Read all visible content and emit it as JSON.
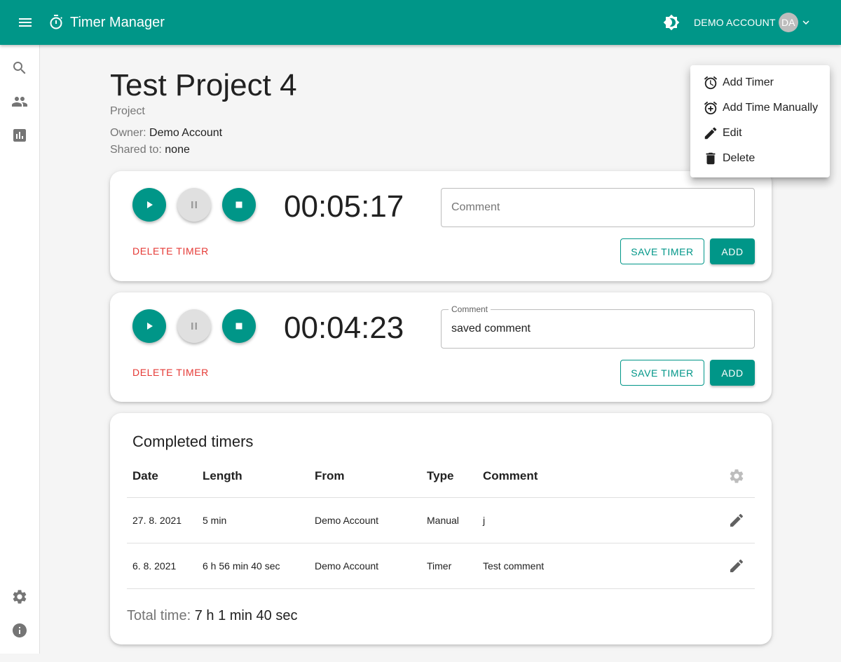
{
  "app": {
    "title": "Timer Manager",
    "account_name": "DEMO ACCOUNT",
    "avatar_initials": "DA",
    "accent_color": "#009688",
    "icons": [
      "menu-icon",
      "timer-icon",
      "brightness-icon",
      "chevron-down-icon",
      "search-icon",
      "people-icon",
      "chart-icon",
      "settings-icon",
      "info-icon"
    ]
  },
  "project": {
    "title": "Test Project 4",
    "type": "Project",
    "owner_label": "Owner:",
    "owner": "Demo Account",
    "shared_label": "Shared to:",
    "shared": "none"
  },
  "timers": [
    {
      "value": "00:05:17",
      "comment_placeholder": "Comment",
      "comment_value": "",
      "delete_label": "DELETE TIMER",
      "save_label": "SAVE TIMER",
      "add_label": "ADD"
    },
    {
      "value": "00:04:23",
      "comment_label": "Comment",
      "comment_value": "saved comment",
      "delete_label": "DELETE TIMER",
      "save_label": "SAVE TIMER",
      "add_label": "ADD"
    }
  ],
  "completed": {
    "title": "Completed timers",
    "headers": {
      "date": "Date",
      "length": "Length",
      "from": "From",
      "type": "Type",
      "comment": "Comment"
    },
    "rows": [
      {
        "date": "27. 8. 2021",
        "length": "5 min",
        "from": "Demo Account",
        "type": "Manual",
        "comment": "j"
      },
      {
        "date": "6. 8. 2021",
        "length": "6 h 56 min 40 sec",
        "from": "Demo Account",
        "type": "Timer",
        "comment": "Test comment"
      }
    ],
    "total_label": "Total time:",
    "total_value": "7 h 1 min 40 sec"
  },
  "menu": {
    "items": [
      {
        "label": "Add Timer",
        "icon": "alarm-icon"
      },
      {
        "label": "Add Time Manually",
        "icon": "alarm-add-icon"
      },
      {
        "label": "Edit",
        "icon": "pencil-icon"
      },
      {
        "label": "Delete",
        "icon": "trash-icon"
      }
    ]
  }
}
